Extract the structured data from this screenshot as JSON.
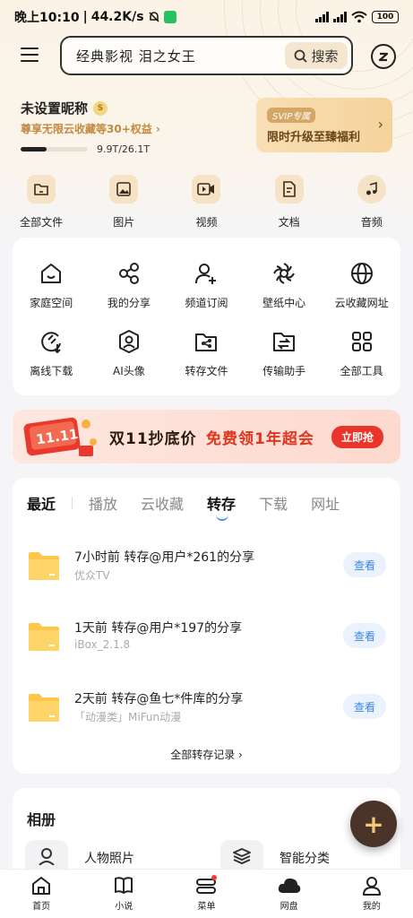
{
  "status_bar": {
    "time": "晚上10:10",
    "speed": "44.2K/s",
    "battery": "100"
  },
  "header": {
    "search_text": "经典影视 泪之女王",
    "search_button": "搜索"
  },
  "profile": {
    "nickname": "未设置昵称",
    "perk": "尊享无限云收藏等30+权益",
    "quota": "9.9T/26.1T",
    "quota_used_ratio": 0.38
  },
  "svip": {
    "tag": "SVIP专属",
    "title": "限时升级至臻福利"
  },
  "categories": [
    {
      "label": "全部文件",
      "icon": "file-icon"
    },
    {
      "label": "图片",
      "icon": "image-icon"
    },
    {
      "label": "视频",
      "icon": "video-icon"
    },
    {
      "label": "文档",
      "icon": "document-icon"
    },
    {
      "label": "音频",
      "icon": "music-icon"
    }
  ],
  "tools": [
    {
      "label": "家庭空间",
      "icon": "home-icon"
    },
    {
      "label": "我的分享",
      "icon": "share-icon"
    },
    {
      "label": "频道订阅",
      "icon": "add-user-icon"
    },
    {
      "label": "壁纸中心",
      "icon": "wallpaper-icon"
    },
    {
      "label": "云收藏网址",
      "icon": "globe-icon"
    },
    {
      "label": "离线下载",
      "icon": "offline-download-icon"
    },
    {
      "label": "AI头像",
      "icon": "ai-avatar-icon"
    },
    {
      "label": "转存文件",
      "icon": "transfer-folder-icon"
    },
    {
      "label": "传输助手",
      "icon": "transfer-assistant-icon"
    },
    {
      "label": "全部工具",
      "icon": "grid-icon"
    }
  ],
  "banner": {
    "badge": "11.11",
    "text": "双11抄底价",
    "highlight": "免费领1年超会",
    "button": "立即抢"
  },
  "recent": {
    "tabs": [
      "最近",
      "播放",
      "云收藏",
      "转存",
      "下载",
      "网址"
    ],
    "active_tab": "转存",
    "items": [
      {
        "title": "7小时前 转存@用户*261的分享",
        "subtitle": "优众TV",
        "button": "查看"
      },
      {
        "title": "1天前 转存@用户*197的分享",
        "subtitle": "iBox_2.1.8",
        "button": "查看"
      },
      {
        "title": "2天前 转存@鱼七*件库的分享",
        "subtitle": "「动漫类」MiFun动漫",
        "button": "查看"
      }
    ],
    "all_records": "全部转存记录 ›"
  },
  "album": {
    "title": "相册",
    "items": [
      "人物照片",
      "智能分类"
    ]
  },
  "fab": {
    "label": "+"
  },
  "tabbar": [
    {
      "label": "首页",
      "icon": "home-icon"
    },
    {
      "label": "小说",
      "icon": "book-icon"
    },
    {
      "label": "菜单",
      "icon": "menu-icon"
    },
    {
      "label": "网盘",
      "icon": "cloud-icon"
    },
    {
      "label": "我的",
      "icon": "person-icon"
    }
  ],
  "colors": {
    "accent": "#4a90e8",
    "gold": "#c18a3f",
    "sale_red": "#e9352a",
    "folder": "#fcc74a"
  }
}
